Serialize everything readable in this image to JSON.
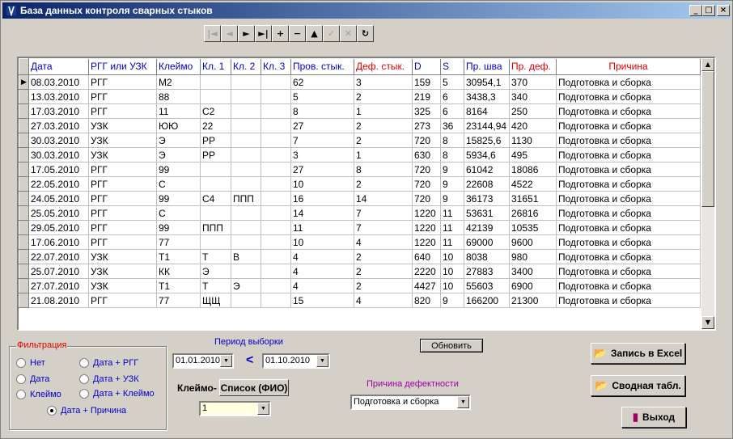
{
  "window": {
    "title": "База данных контроля сварных стыков",
    "controls": {
      "minimize": "_",
      "maximize": "□",
      "close": "×"
    }
  },
  "navigator": [
    {
      "name": "first-record-button",
      "glyph": "|◄",
      "enabled": false
    },
    {
      "name": "prior-record-button",
      "glyph": "◄",
      "enabled": false
    },
    {
      "name": "next-record-button",
      "glyph": "►",
      "enabled": true
    },
    {
      "name": "last-record-button",
      "glyph": "►|",
      "enabled": true
    },
    {
      "name": "insert-record-button",
      "glyph": "+",
      "enabled": true
    },
    {
      "name": "delete-record-button",
      "glyph": "−",
      "enabled": true
    },
    {
      "name": "edit-record-button",
      "glyph": "▲",
      "enabled": true
    },
    {
      "name": "post-record-button",
      "glyph": "✓",
      "enabled": false
    },
    {
      "name": "cancel-record-button",
      "glyph": "✕",
      "enabled": false
    },
    {
      "name": "refresh-record-button",
      "glyph": "↻",
      "enabled": true
    }
  ],
  "grid": {
    "columns": [
      {
        "label": "Дата",
        "width": 74,
        "color": "blue"
      },
      {
        "label": "РГГ или УЗК",
        "width": 84,
        "color": "blue"
      },
      {
        "label": "Клеймо",
        "width": 54,
        "color": "blue"
      },
      {
        "label": "Кл. 1",
        "width": 38,
        "color": "blue"
      },
      {
        "label": "Кл. 2",
        "width": 37,
        "color": "blue"
      },
      {
        "label": "Кл. 3",
        "width": 37,
        "color": "blue"
      },
      {
        "label": "Пров. стык.",
        "width": 78,
        "color": "blue"
      },
      {
        "label": "Деф. стык.",
        "width": 72,
        "color": "red"
      },
      {
        "label": "D",
        "width": 35,
        "color": "blue"
      },
      {
        "label": "S",
        "width": 29,
        "color": "blue"
      },
      {
        "label": "Пр. шва",
        "width": 56,
        "color": "blue"
      },
      {
        "label": "Пр. деф.",
        "width": 58,
        "color": "red"
      },
      {
        "label": "Причина",
        "width": 178,
        "color": "red",
        "center": true
      }
    ],
    "rows": [
      [
        "08.03.2010",
        "РГГ",
        "М2",
        "",
        "",
        "",
        "62",
        "3",
        "159",
        "5",
        "30954,1",
        "370",
        "Подготовка и сборка"
      ],
      [
        "13.03.2010",
        "РГГ",
        "88",
        "",
        "",
        "",
        "5",
        "2",
        "219",
        "6",
        "3438,3",
        "340",
        "Подготовка и сборка"
      ],
      [
        "17.03.2010",
        "РГГ",
        "11",
        "С2",
        "",
        "",
        "8",
        "1",
        "325",
        "6",
        "8164",
        "250",
        "Подготовка и сборка"
      ],
      [
        "27.03.2010",
        "УЗК",
        "ЮЮ",
        "22",
        "",
        "",
        "27",
        "2",
        "273",
        "36",
        "23144,94",
        "420",
        "Подготовка и сборка"
      ],
      [
        "30.03.2010",
        "УЗК",
        "Э",
        "РР",
        "",
        "",
        "7",
        "2",
        "720",
        "8",
        "15825,6",
        "1130",
        "Подготовка и сборка"
      ],
      [
        "30.03.2010",
        "УЗК",
        "Э",
        "РР",
        "",
        "",
        "3",
        "1",
        "630",
        "8",
        "5934,6",
        "495",
        "Подготовка и сборка"
      ],
      [
        "17.05.2010",
        "РГГ",
        "99",
        "",
        "",
        "",
        "27",
        "8",
        "720",
        "9",
        "61042",
        "18086",
        "Подготовка и сборка"
      ],
      [
        "22.05.2010",
        "РГГ",
        "С",
        "",
        "",
        "",
        "10",
        "2",
        "720",
        "9",
        "22608",
        "4522",
        "Подготовка и сборка"
      ],
      [
        "24.05.2010",
        "РГГ",
        "99",
        "С4",
        "ППП",
        "",
        "16",
        "14",
        "720",
        "9",
        "36173",
        "31651",
        "Подготовка и сборка"
      ],
      [
        "25.05.2010",
        "РГГ",
        "С",
        "",
        "",
        "",
        "14",
        "7",
        "1220",
        "11",
        "53631",
        "26816",
        "Подготовка и сборка"
      ],
      [
        "29.05.2010",
        "РГГ",
        "99",
        "ППП",
        "",
        "",
        "11",
        "7",
        "1220",
        "11",
        "42139",
        "10535",
        "Подготовка и сборка"
      ],
      [
        "17.06.2010",
        "РГГ",
        "77",
        "",
        "",
        "",
        "10",
        "4",
        "1220",
        "11",
        "69000",
        "9600",
        "Подготовка и сборка"
      ],
      [
        "22.07.2010",
        "УЗК",
        "Т1",
        "Т",
        "В",
        "",
        "4",
        "2",
        "640",
        "10",
        "8038",
        "980",
        "Подготовка и сборка"
      ],
      [
        "25.07.2010",
        "УЗК",
        "КК",
        "Э",
        "",
        "",
        "4",
        "2",
        "2220",
        "10",
        "27883",
        "3400",
        "Подготовка и сборка"
      ],
      [
        "27.07.2010",
        "УЗК",
        "Т1",
        "Т",
        "Э",
        "",
        "4",
        "2",
        "4427",
        "10",
        "55603",
        "6900",
        "Подготовка и сборка"
      ],
      [
        "21.08.2010",
        "РГГ",
        "77",
        "ЩЩ",
        "",
        "",
        "15",
        "4",
        "820",
        "9",
        "166200",
        "21300",
        "Подготовка и сборка"
      ]
    ],
    "current_row_marker": "▶"
  },
  "filter": {
    "legend": "Фильтрация",
    "options": [
      {
        "label": "Нет",
        "selected": false
      },
      {
        "label": "Дата + РГГ",
        "selected": false
      },
      {
        "label": "Дата",
        "selected": false
      },
      {
        "label": "Дата + УЗК",
        "selected": false
      },
      {
        "label": "Клеймо",
        "selected": false
      },
      {
        "label": "Дата + Клеймо",
        "selected": false
      },
      {
        "label": "Дата + Причина",
        "selected": true
      }
    ]
  },
  "period": {
    "label": "Период выборки",
    "from": "01.01.2010",
    "separator": "<",
    "to": "01.10.2010"
  },
  "stamp": {
    "label": "Клеймо-",
    "list_button": "Список (ФИО)",
    "value": "1"
  },
  "refresh_button": "Обновить",
  "defect_reason": {
    "label": "Причина дефектности",
    "value": "Подготовка и сборка"
  },
  "actions": {
    "excel": "Запись в Excel",
    "summary": "Сводная табл.",
    "exit": "Выход"
  },
  "colors": {
    "blue_text": "#0000c8",
    "red_text": "#e00000",
    "face": "#d4d0c8",
    "title_start": "#0a246a"
  }
}
